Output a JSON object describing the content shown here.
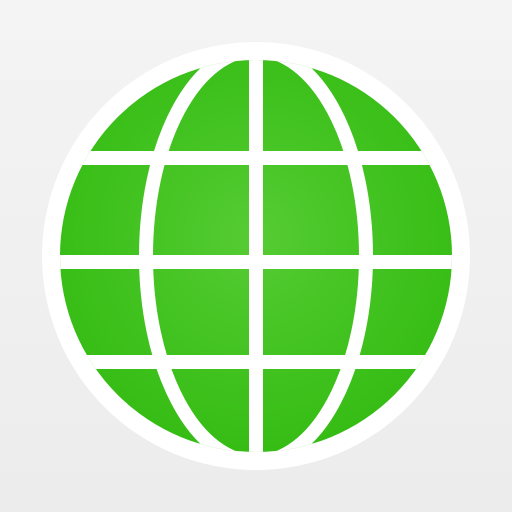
{
  "icon": {
    "name": "globe-icon",
    "colors": {
      "background": "#efefef",
      "ring": "#ffffff",
      "globe_light": "#55cc33",
      "globe_dark": "#33bb11",
      "grid_lines": "#ffffff"
    }
  }
}
